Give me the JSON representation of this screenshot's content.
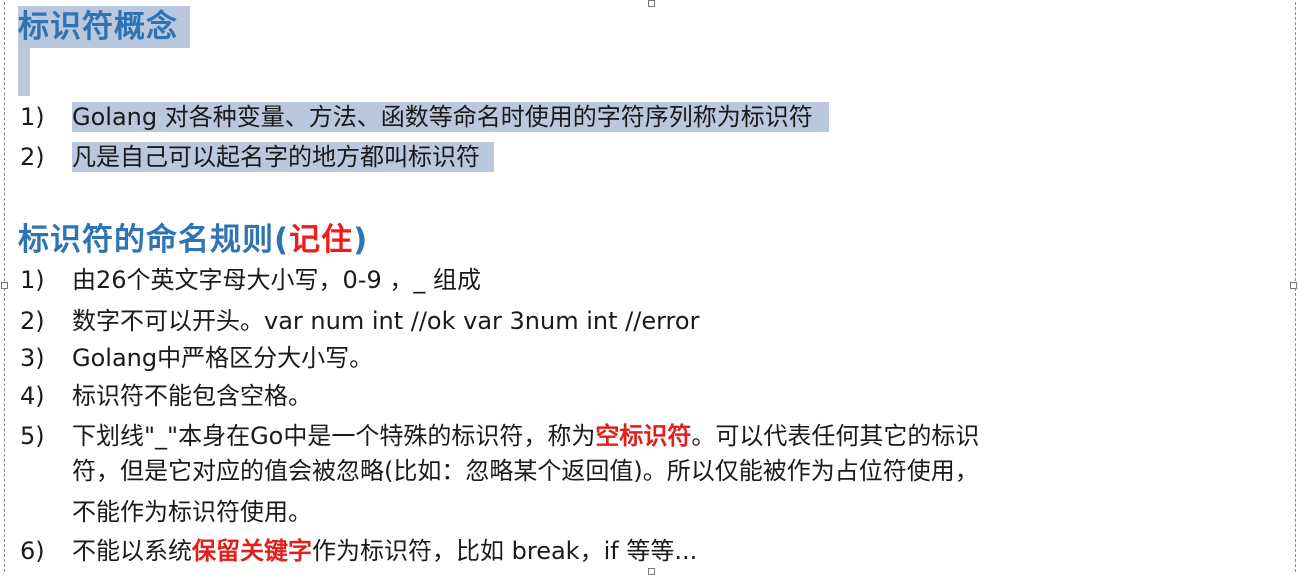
{
  "section1": {
    "title": "标识符概念",
    "items": [
      {
        "num": "1)",
        "text": "Golang 对各种变量、方法、函数等命名时使用的字符序列称为标识符"
      },
      {
        "num": "2)",
        "text": "凡是自己可以起名字的地方都叫标识符"
      }
    ]
  },
  "section2": {
    "title_prefix": "标识符的命名规则(",
    "title_highlight": "记住",
    "title_suffix": ")",
    "items": [
      {
        "num": "1)",
        "text": "由26个英文字母大小写，0-9 ，_ 组成"
      },
      {
        "num": "2)",
        "text": "数字不可以开头。var num  int //ok   var 3num  int //error"
      },
      {
        "num": "3)",
        "text": "Golang中严格区分大小写。"
      },
      {
        "num": "4)",
        "text": "标识符不能包含空格。"
      },
      {
        "num": "5)",
        "text_before": "下划线\"_\"本身在Go中是一个特殊的标识符，称为",
        "text_highlight": "空标识符",
        "line1_after": "。可以代表任何其它的标识",
        "line2": "符，但是它对应的值会被忽略(比如：忽略某个返回值)。所以仅能被作为占位符使用，",
        "line3": "不能作为标识符使用。"
      },
      {
        "num": "6)",
        "text_before": "不能以系统",
        "text_highlight": "保留关键字",
        "text_after": "作为标识符，比如 break，if 等等..."
      }
    ]
  },
  "colors": {
    "heading": "#2e74b5",
    "highlight_red": "#e0211b",
    "selection": "#b9c8dc"
  }
}
